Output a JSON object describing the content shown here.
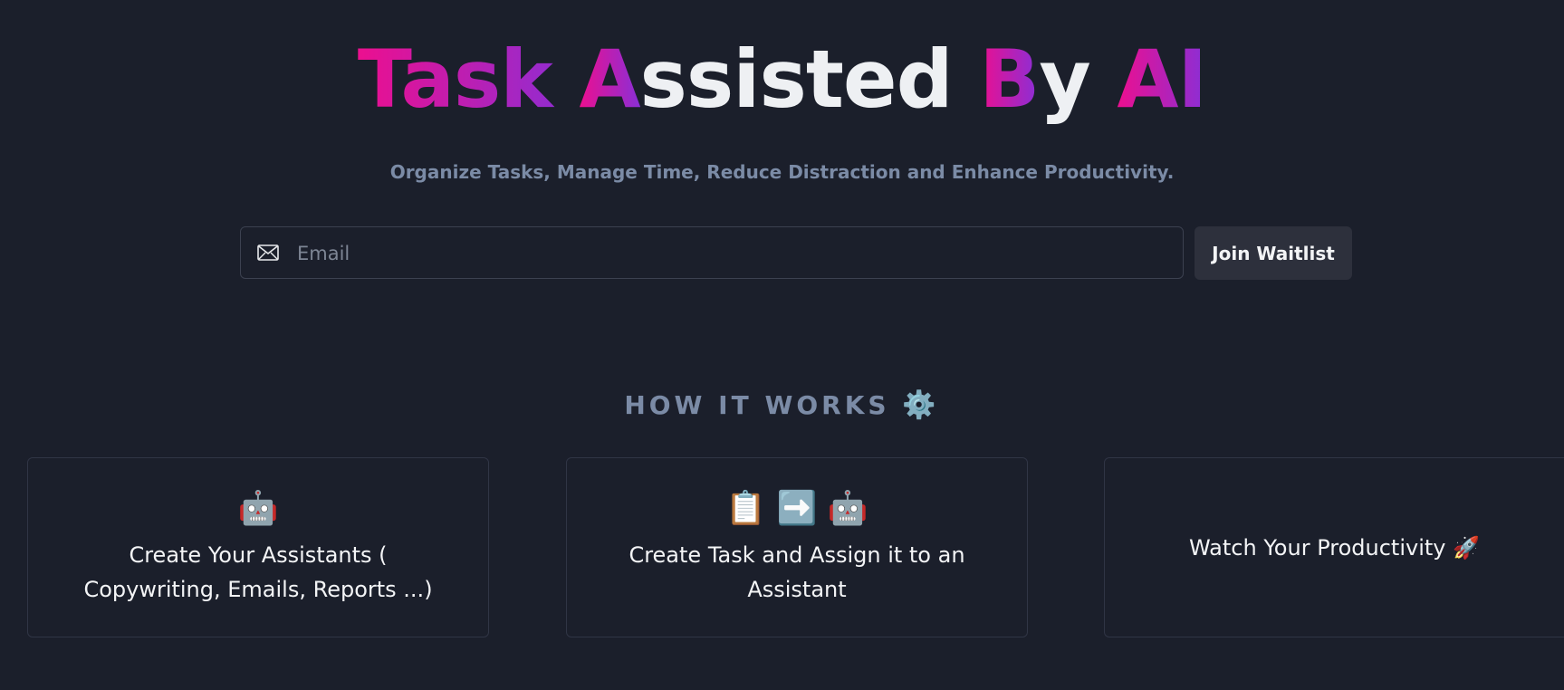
{
  "hero": {
    "title_parts": [
      {
        "text": "Task ",
        "style": "grad"
      },
      {
        "text": "A",
        "style": "grad"
      },
      {
        "text": "ssisted ",
        "style": "plain"
      },
      {
        "text": "B",
        "style": "grad"
      },
      {
        "text": "y ",
        "style": "plain"
      },
      {
        "text": "AI",
        "style": "grad"
      }
    ],
    "subtitle": "Organize Tasks, Manage Time, Reduce Distraction and Enhance Productivity."
  },
  "signup": {
    "email_placeholder": "Email",
    "email_value": "",
    "button_label": "Join Waitlist",
    "icon": "mail-icon"
  },
  "how_it_works": {
    "heading": "HOW IT WORKS",
    "heading_icon": "⚙️",
    "cards": [
      {
        "icons": "🤖",
        "text": "Create Your Assistants ( Copywriting, Emails, Reports ...)"
      },
      {
        "icons": "📋 ➡️ 🤖",
        "text": "Create Task and Assign it to an Assistant"
      },
      {
        "icons": "",
        "text": "Watch Your Productivity",
        "trailing_icon": "🚀"
      }
    ]
  },
  "colors": {
    "background": "#1b1f2b",
    "gradient_start": "#ec0f8f",
    "gradient_end": "#8a2fd6",
    "muted": "#7b8ba6"
  }
}
